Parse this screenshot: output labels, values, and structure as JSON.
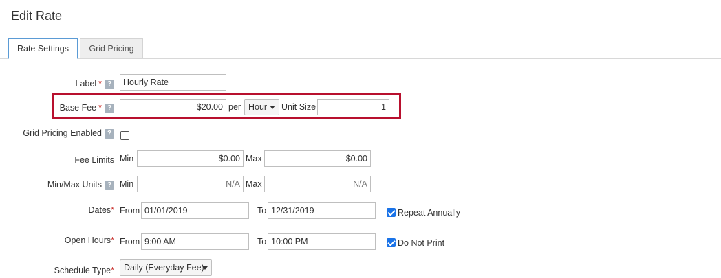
{
  "page": {
    "title": "Edit Rate"
  },
  "tabs": [
    {
      "label": "Rate Settings",
      "active": true
    },
    {
      "label": "Grid Pricing",
      "active": false
    }
  ],
  "help_glyph": "?",
  "required_mark": "*",
  "form": {
    "label": {
      "label": "Label",
      "value": "Hourly Rate"
    },
    "base_fee": {
      "label": "Base Fee",
      "value": "$20.00",
      "per_label": "per",
      "per_unit": "Hour",
      "unit_size_label": "Unit Size",
      "unit_size": "1"
    },
    "grid_pricing": {
      "label": "Grid Pricing Enabled",
      "checked": false
    },
    "fee_limits": {
      "label": "Fee Limits",
      "min_label": "Min",
      "min_value": "$0.00",
      "max_label": "Max",
      "max_value": "$0.00"
    },
    "min_max_units": {
      "label": "Min/Max Units",
      "min_label": "Min",
      "min_placeholder": "N/A",
      "max_label": "Max",
      "max_placeholder": "N/A"
    },
    "dates": {
      "label": "Dates",
      "from_label": "From",
      "from_value": "01/01/2019",
      "to_label": "To",
      "to_value": "12/31/2019",
      "repeat_label": "Repeat Annually",
      "repeat_checked": true
    },
    "open_hours": {
      "label": "Open Hours",
      "from_label": "From",
      "from_value": "9:00 AM",
      "to_label": "To",
      "to_value": "10:00 PM",
      "do_not_print_label": "Do Not Print",
      "do_not_print_checked": true
    },
    "schedule_type": {
      "label": "Schedule Type",
      "value": "Daily (Everyday Fee)"
    }
  },
  "colors": {
    "highlight": "#b8102e",
    "required": "#c9302c",
    "tab_active_border": "#5b9bd5",
    "checkbox": "#1a73e8"
  }
}
